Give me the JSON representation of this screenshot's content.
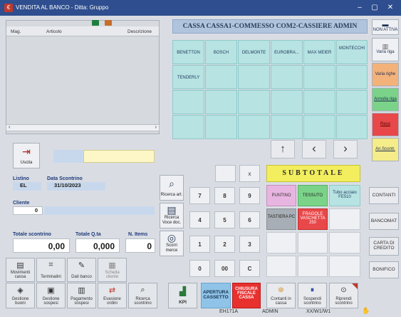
{
  "window": {
    "title": "VENDITA AL BANCO - Ditta: Gruppo",
    "minimize": "–",
    "maximize": "▢",
    "close": "✕"
  },
  "left_panel": {
    "columns": [
      "Mag.",
      "Articolo",
      "Descrizione"
    ],
    "exit_label": "Uscita"
  },
  "header": {
    "title": "CASSA CASSA1-COMMESSO COM2-CASSIERE ADMIN"
  },
  "brands": [
    [
      "BENETTON",
      "BOSCH",
      "DELMONTE",
      "EUROBRA...",
      "MAX MEIER",
      "MONTECCHI"
    ],
    [
      "TENDERLY",
      "",
      "",
      "",
      "",
      ""
    ]
  ],
  "side_buttons": [
    {
      "label": "NON ATTIVA"
    },
    {
      "label": "Varia riga"
    },
    {
      "label": "Varia righe"
    },
    {
      "label": "Annulla riga"
    },
    {
      "label": "Reso"
    },
    {
      "label": "An.Scontr."
    }
  ],
  "info": {
    "listino_label": "Listino",
    "listino_value": "EL",
    "data_label": "Data Scontrino",
    "data_value": "31/10/2023",
    "cliente_label": "Cliente",
    "cliente_value": "0",
    "totale_label": "Totale scontrino",
    "totale_value": "0,00",
    "qta_label": "Totale Q.ta",
    "qta_value": "0,000",
    "items_label": "N. Items",
    "items_value": "0"
  },
  "mid_buttons": [
    "Ricerca art.",
    "Ricerca Voce doc.",
    "Scorri merce"
  ],
  "numpad": [
    "",
    "x",
    "7",
    "8",
    "9",
    "4",
    "5",
    "6",
    "1",
    "2",
    "3",
    "0",
    "00",
    "C"
  ],
  "subtotal": "SUBTOTALE",
  "product_buttons": [
    {
      "label": "PUNTINO",
      "color": "#e8b4e0"
    },
    {
      "label": "TESSUTO",
      "color": "#7bd389"
    },
    {
      "label": "Tubo acciaio FE510",
      "color": "#b7e3e3"
    },
    {
      "label": "TASTIERA PC",
      "color": "#a8aeb5"
    },
    {
      "label": "FRAGOLE VASCHETTA 250",
      "color": "#e8484a"
    }
  ],
  "payment_buttons": [
    "CONTANTI",
    "BANCOMAT",
    "CARTA DI CREDITO",
    "BONIFICO"
  ],
  "func_row1": [
    "Movimenti cassa",
    "Terminalini",
    "Dati banco",
    "Scheda cliente"
  ],
  "func_row2": [
    "Gestione buoni",
    "Gestione sospesi",
    "Pagamento sospesi",
    "Evasione ordini",
    "Ricerca scontrino",
    "KPI"
  ],
  "apertura": "APERTURA CASSETTO",
  "chiusura": "CHIUSURA FISCALE CASSA",
  "bottom_actions": [
    "Contanti in cassa",
    "Sospendi scontrino",
    "Riprendi scontrino"
  ],
  "status": {
    "code": "EH171A",
    "user": "ADMIN",
    "position": "XX/W1/W1"
  }
}
